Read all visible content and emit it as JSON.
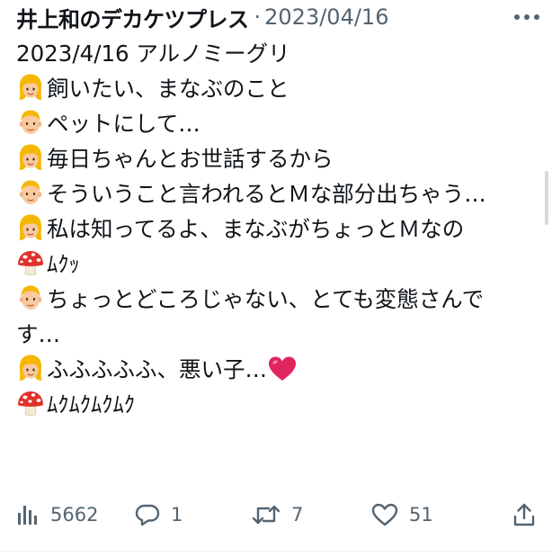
{
  "tweet": {
    "author": "井上和のデカケツプレス",
    "separator": "·",
    "date": "2023/04/16",
    "lines": [
      {
        "text": "2023/4/16 アルノミーグリ",
        "emoji": ""
      },
      {
        "text": "飼いたい、まなぶのこと",
        "emoji": "woman-emoji"
      },
      {
        "text": "ペットにして…",
        "emoji": "man-emoji"
      },
      {
        "text": "毎日ちゃんとお世話するから",
        "emoji": "woman-emoji"
      },
      {
        "text": "そういうこと言われるとＭな部分出ちゃう…",
        "emoji": "man-emoji"
      },
      {
        "text": "私は知ってるよ、まなぶがちょっとＭなの",
        "emoji": "woman-emoji"
      },
      {
        "text": "ﾑｸｯ",
        "emoji": "mushroom-emoji"
      },
      {
        "text": "ちょっとどころじゃない、とても変態さんです…",
        "emoji": "man-emoji"
      },
      {
        "text": "ふふふふふ、悪い子…",
        "emoji": "woman-emoji",
        "trailing_emoji": "red-heart-emoji"
      },
      {
        "text": "ﾑｸﾑｸﾑｸﾑｸ",
        "emoji": "mushroom-emoji"
      }
    ]
  },
  "actions": {
    "views": {
      "count": "5662",
      "icon": "analytics-icon"
    },
    "reply": {
      "count": "1",
      "icon": "reply-icon"
    },
    "repost": {
      "count": "7",
      "icon": "repost-icon"
    },
    "like": {
      "count": "51",
      "icon": "heart-icon"
    },
    "share": {
      "icon": "share-icon"
    }
  },
  "colors": {
    "text": "#0f1419",
    "secondary": "#536471",
    "heart_red": "#e0245e"
  }
}
